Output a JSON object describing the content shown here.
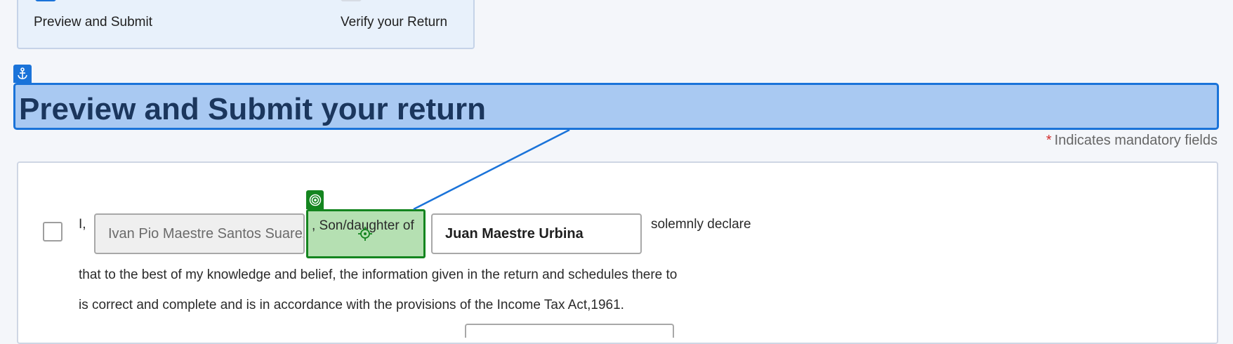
{
  "stepper": {
    "step1_label": "Preview and Submit",
    "step2_label": "Verify your Return"
  },
  "header": {
    "title": "Preview and Submit your return",
    "mandatory_star": "*",
    "mandatory_note": "Indicates mandatory fields"
  },
  "declaration": {
    "prefix": "I,",
    "name_value": "Ivan Pio Maestre Santos Suarez",
    "relation_label": ", Son/daughter of",
    "parent_name_value": "Juan Maestre Urbina",
    "suffix": "solemnly declare",
    "line2": "that to the best of my knowledge and belief, the information given in the return and schedules there to",
    "line3": "is correct and complete and is in accordance with the provisions of the Income Tax Act,1961."
  },
  "colors": {
    "accent_blue": "#1a73d9",
    "highlight_green": "#14851f",
    "title_text": "#1b365d"
  },
  "icons": {
    "anchor": "anchor-icon",
    "target": "target-icon",
    "crosshair": "crosshair-icon"
  }
}
